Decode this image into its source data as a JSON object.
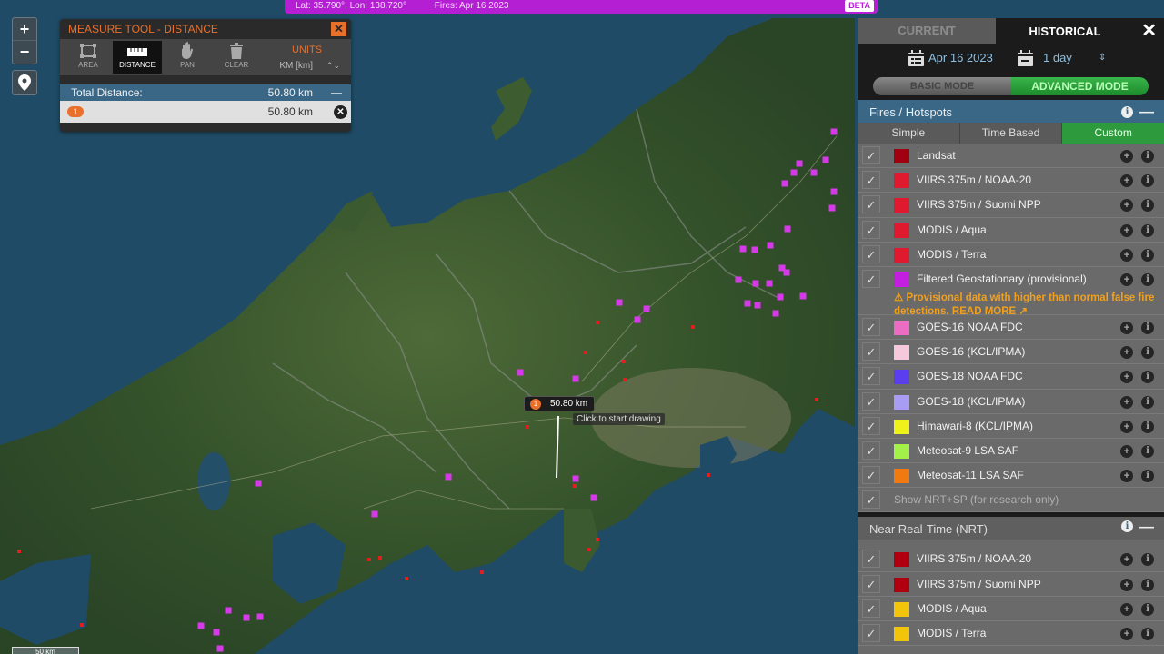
{
  "status_bar": {
    "coords": "Lat: 35.790°, Lon: 138.720°",
    "fires_date": "Fires: Apr 16 2023",
    "beta": "BETA"
  },
  "zoom_controls": {
    "zoom_in": "+",
    "zoom_out": "−"
  },
  "measure_tool": {
    "title": "MEASURE TOOL - DISTANCE",
    "close": "✕",
    "tools": [
      {
        "label": "AREA",
        "icon": "area-icon",
        "active": false
      },
      {
        "label": "DISTANCE",
        "icon": "ruler-icon",
        "active": true
      },
      {
        "label": "PAN",
        "icon": "hand-icon",
        "active": false
      },
      {
        "label": "CLEAR",
        "icon": "trash-icon",
        "active": false
      }
    ],
    "units_label": "UNITS",
    "units_value": "KM [km]",
    "total_label": "Total Distance:",
    "total_value": "50.80 km",
    "segments": [
      {
        "index": "1",
        "value": "50.80 km"
      }
    ]
  },
  "map": {
    "distance_label": "50.80 km",
    "distance_index": "1",
    "draw_hint": "Click to start drawing",
    "scale": "50 km",
    "colors": {
      "water": "#1f4f6b",
      "land": "#3e5a2c",
      "hotspot": "#d63ae8",
      "fire": "#e02020"
    }
  },
  "panel": {
    "tab_current": "CURRENT",
    "tab_historical": "HISTORICAL",
    "close": "✕",
    "date": "Apr 16 2023",
    "duration": "1 day",
    "mode_basic": "BASIC MODE",
    "mode_advanced": "ADVANCED MODE",
    "fires_section": {
      "title": "Fires / Hotspots",
      "subtabs": [
        "Simple",
        "Time Based",
        "Custom"
      ],
      "selected_subtab": "Custom",
      "layers": [
        {
          "label": "Landsat",
          "color": "#a00010",
          "checked": true
        },
        {
          "label": "VIIRS 375m / NOAA-20",
          "color": "#e0192e",
          "checked": true
        },
        {
          "label": "VIIRS 375m / Suomi NPP",
          "color": "#e0192e",
          "checked": true
        },
        {
          "label": "MODIS / Aqua",
          "color": "#e0192e",
          "checked": true
        },
        {
          "label": "MODIS / Terra",
          "color": "#e0192e",
          "checked": true
        },
        {
          "label": "Filtered Geostationary (provisional)",
          "color": "#c41ee0",
          "checked": true
        },
        {
          "label": "GOES-16 NOAA FDC",
          "color": "#ec6cc4",
          "checked": true
        },
        {
          "label": "GOES-16 (KCL/IPMA)",
          "color": "#f6c8dc",
          "checked": true
        },
        {
          "label": "GOES-18 NOAA FDC",
          "color": "#5a3ef0",
          "checked": true
        },
        {
          "label": "GOES-18 (KCL/IPMA)",
          "color": "#a89cf4",
          "checked": true
        },
        {
          "label": "Himawari-8 (KCL/IPMA)",
          "color": "#eef21a",
          "checked": true
        },
        {
          "label": "Meteosat-9 LSA SAF",
          "color": "#a2f048",
          "checked": true
        },
        {
          "label": "Meteosat-11 LSA SAF",
          "color": "#f07a10",
          "checked": true
        }
      ],
      "warning": "Provisional data with higher than normal false fire detections.",
      "read_more": "READ MORE",
      "show_nrt_sp": "Show NRT+SP (for research only)"
    },
    "nrt_section": {
      "title": "Near Real-Time (NRT)",
      "layers": [
        {
          "label": "VIIRS 375m / NOAA-20",
          "color": "#b00010",
          "checked": true
        },
        {
          "label": "VIIRS 375m / Suomi NPP",
          "color": "#b00010",
          "checked": true
        },
        {
          "label": "MODIS / Aqua",
          "color": "#f2c40a",
          "checked": true
        },
        {
          "label": "MODIS / Terra",
          "color": "#f2c40a",
          "checked": true
        }
      ]
    }
  }
}
